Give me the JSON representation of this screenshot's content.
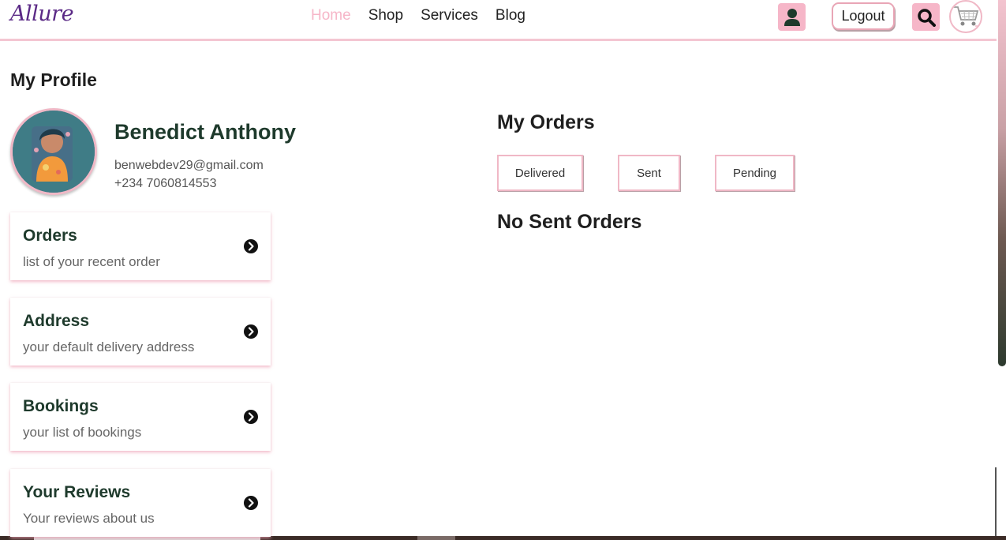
{
  "brand": {
    "logo": "Allure"
  },
  "nav": {
    "links": [
      {
        "label": "Home",
        "active": true
      },
      {
        "label": "Shop"
      },
      {
        "label": "Services"
      },
      {
        "label": "Blog"
      }
    ],
    "logout_label": "Logout",
    "icons": [
      "user-icon",
      "search-icon",
      "cart-icon"
    ]
  },
  "profile": {
    "page_title": "My Profile",
    "name": "Benedict Anthony",
    "email": "benwebdev29@gmail.com",
    "phone": "+234 7060814553"
  },
  "menu": [
    {
      "title": "Orders",
      "subtitle": "list of your recent order"
    },
    {
      "title": "Address",
      "subtitle": "your default delivery address"
    },
    {
      "title": "Bookings",
      "subtitle": "your list of bookings"
    },
    {
      "title": "Your Reviews",
      "subtitle": "Your reviews about us"
    }
  ],
  "orders": {
    "title": "My Orders",
    "tabs": [
      "Delivered",
      "Sent",
      "Pending"
    ],
    "selected_tab": "Sent",
    "empty_message": "No Sent Orders"
  },
  "colors": {
    "accent_pink": "#f6b6c8",
    "brand_purple": "#5b2a86",
    "heading_green": "#1e3a2c"
  }
}
